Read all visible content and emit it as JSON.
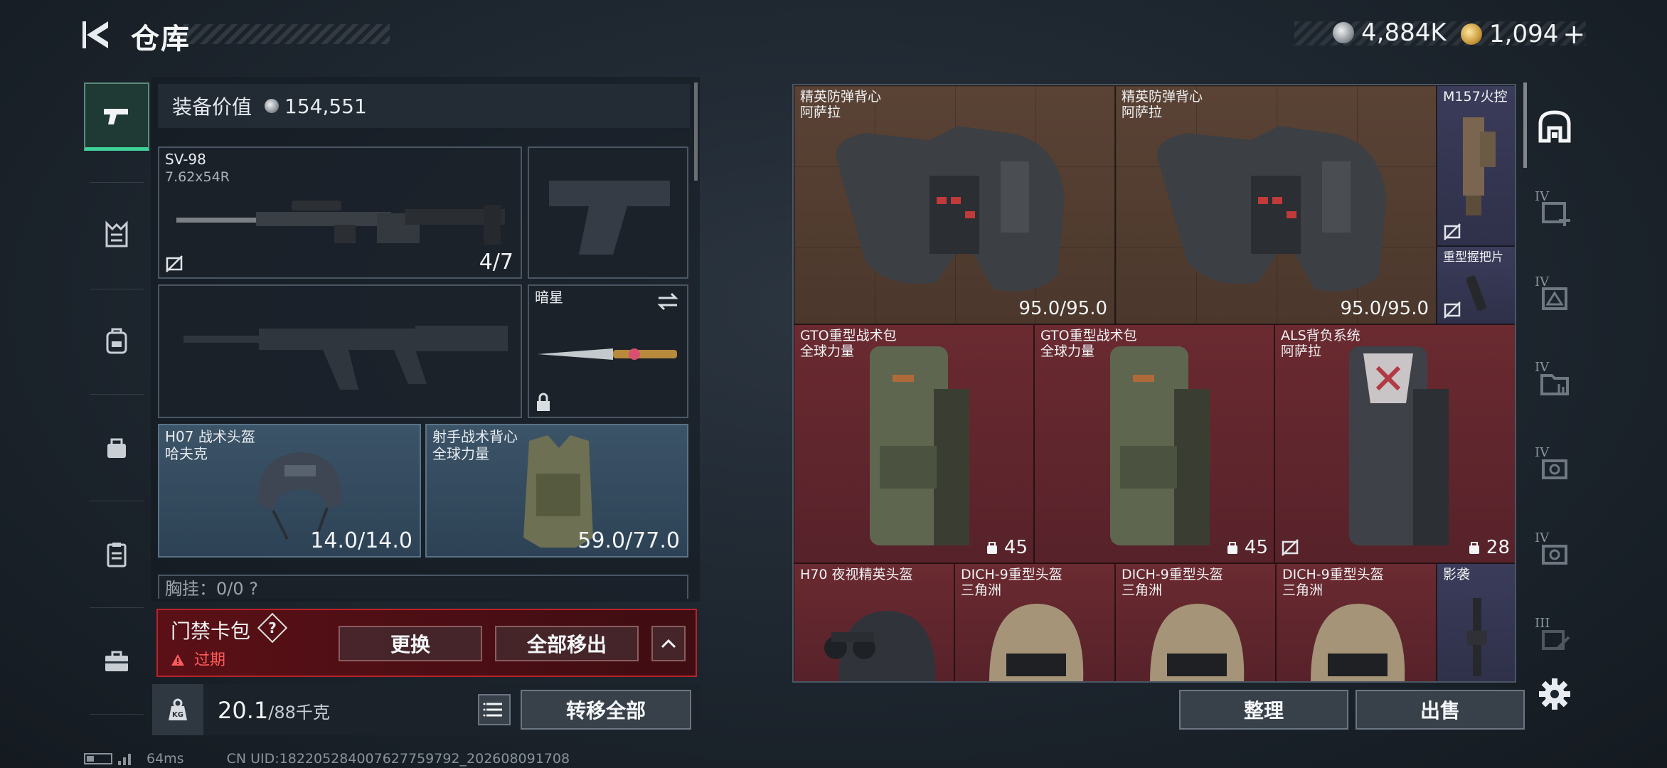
{
  "header": {
    "title": "仓库",
    "currency": [
      {
        "icon": "silver-coin-icon",
        "value": "4,884K"
      },
      {
        "icon": "gold-coin-icon",
        "value": "1,094"
      }
    ],
    "add_label": "+"
  },
  "left_rail": {
    "items": [
      {
        "icon": "pistol-icon",
        "active": true
      },
      {
        "icon": "chest-rig-icon"
      },
      {
        "icon": "backpack-icon"
      },
      {
        "icon": "pouch-icon"
      },
      {
        "icon": "clipboard-icon"
      },
      {
        "icon": "briefcase-icon"
      }
    ]
  },
  "equipment": {
    "value_label": "装备价值",
    "value": "154,551",
    "primary_weapon": {
      "name": "SV-98",
      "caliber": "7.62x54R",
      "ammo": "4/7"
    },
    "melee": {
      "name": "暗星"
    },
    "helmet": {
      "name": "H07 战术头盔",
      "brand": "哈夫克",
      "durability": "14.0/14.0"
    },
    "armor": {
      "name": "射手战术背心",
      "brand": "全球力量",
      "durability": "59.0/77.0"
    },
    "chest_rig_partial": "胸挂：0/0  ?"
  },
  "access_card": {
    "title": "门禁卡包",
    "help": "?",
    "status": "过期",
    "replace_label": "更换",
    "remove_all_label": "全部移出"
  },
  "weight": {
    "current": "20.1",
    "max": "/88千克",
    "transfer_all_label": "转移全部"
  },
  "stash": {
    "items": [
      {
        "name": "精英防弹背心",
        "brand": "阿萨拉",
        "durability": "95.0/95.0"
      },
      {
        "name": "精英防弹背心",
        "brand": "阿萨拉",
        "durability": "95.0/95.0"
      },
      {
        "name": "M157火控",
        "brand": ""
      },
      {
        "name": "重型握把片",
        "brand": ""
      },
      {
        "name": "GTO重型战术包",
        "brand": "全球力量",
        "count": "45"
      },
      {
        "name": "GTO重型战术包",
        "brand": "全球力量",
        "count": "45"
      },
      {
        "name": "ALS背负系统",
        "brand": "阿萨拉",
        "count": "28"
      },
      {
        "name": "H70 夜视精英头盔",
        "brand": ""
      },
      {
        "name": "DICH-9重型头盔",
        "brand": "三角洲"
      },
      {
        "name": "DICH-9重型头盔",
        "brand": "三角洲"
      },
      {
        "name": "DICH-9重型头盔",
        "brand": "三角洲"
      },
      {
        "name": "影袭",
        "brand": ""
      }
    ]
  },
  "right_rail": {
    "levels": [
      "IV",
      "IV",
      "IV",
      "IV",
      "IV",
      "III"
    ]
  },
  "actions": {
    "sort_label": "整理",
    "sell_label": "出售"
  },
  "footer": {
    "ping": "64ms",
    "uid": "CN UID:182205284007627759792_202608091708"
  },
  "colors": {
    "accent_green": "#3fd29a",
    "warning_red": "#b8232b",
    "rare_brown": "#5a4335",
    "rare_red": "#6a2a30",
    "rare_purple": "#3b3c5a"
  }
}
